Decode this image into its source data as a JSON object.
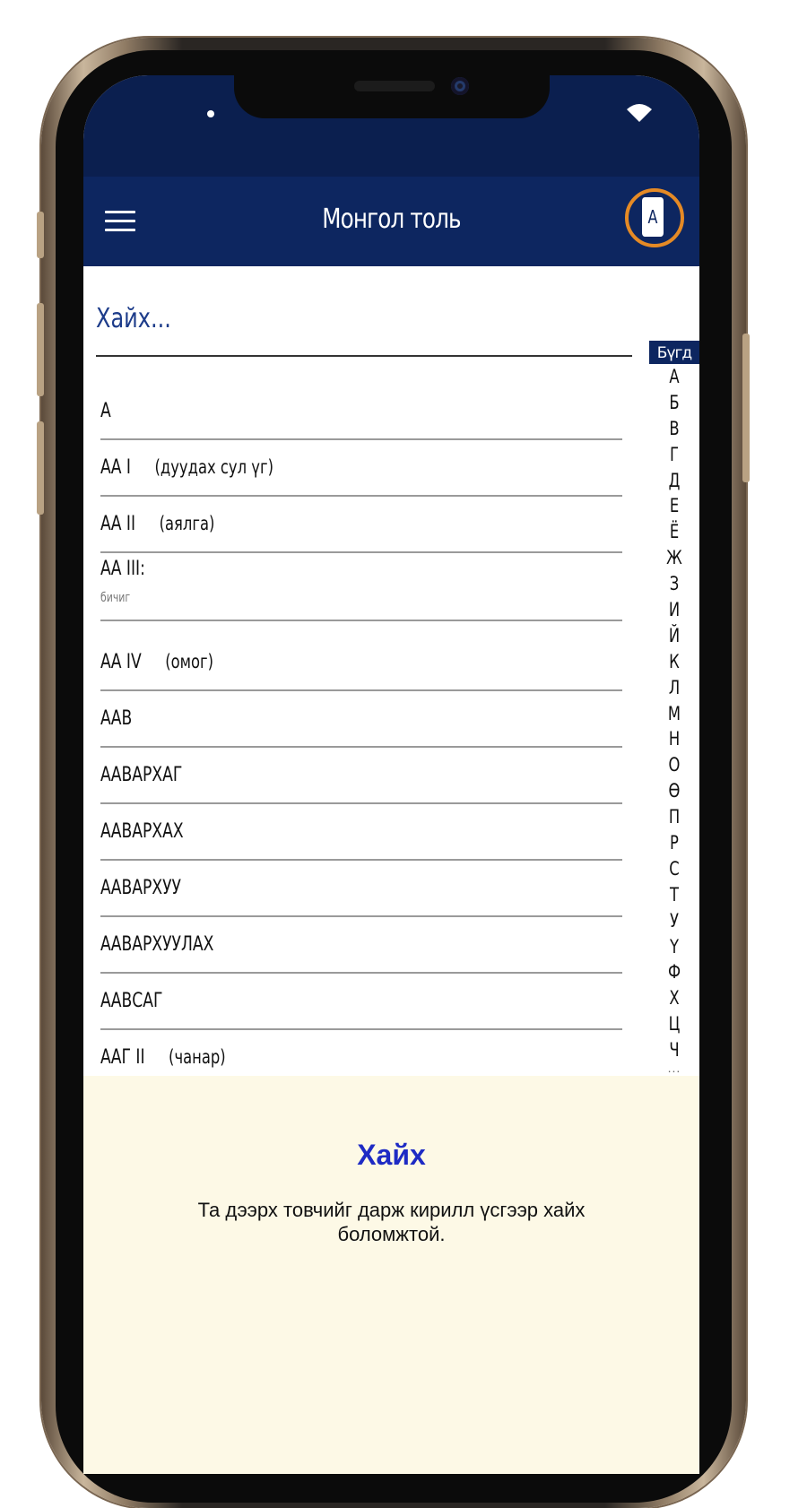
{
  "header": {
    "title": "Монгол толь",
    "alphabet_button": "А"
  },
  "search": {
    "placeholder": "Хайх..."
  },
  "index": {
    "all_label": "Бүгд",
    "letters": [
      "А",
      "Б",
      "В",
      "Г",
      "Д",
      "Е",
      "Ё",
      "Ж",
      "З",
      "И",
      "Й",
      "К",
      "Л",
      "М",
      "Н",
      "О",
      "Ө",
      "П",
      "Р",
      "С",
      "Т",
      "У",
      "Ү",
      "Ф",
      "Х",
      "Ц",
      "Ч"
    ],
    "more": "..."
  },
  "words": [
    {
      "head": "А",
      "note": "",
      "sub": ""
    },
    {
      "head": "АА I",
      "note": "(дуудах сул үг)",
      "sub": ""
    },
    {
      "head": "АА II",
      "note": "(аялга)",
      "sub": ""
    },
    {
      "head": "АА III:",
      "note": "",
      "sub": "бичиг"
    },
    {
      "head": "АА IV",
      "note": "(омог)",
      "sub": ""
    },
    {
      "head": "ААВ",
      "note": "",
      "sub": ""
    },
    {
      "head": "ААВАРХАГ",
      "note": "",
      "sub": ""
    },
    {
      "head": "ААВАРХАХ",
      "note": "",
      "sub": ""
    },
    {
      "head": "ААВАРХУУ",
      "note": "",
      "sub": ""
    },
    {
      "head": "ААВАРХУУЛАХ",
      "note": "",
      "sub": ""
    },
    {
      "head": "ААВСАГ",
      "note": "",
      "sub": ""
    },
    {
      "head": "ААГ II",
      "note": "(чанар)",
      "sub": ""
    }
  ],
  "info": {
    "title": "Хайх",
    "text": "Та дээрх товчийг дарж кирилл үсгээр хайх боломжтой."
  },
  "colors": {
    "app_bar": "#0d2660",
    "status_bar": "#0b1f4f",
    "highlight_ring": "#e58a25",
    "info_bg": "#fdf9e6",
    "info_title": "#1e2bc4"
  }
}
